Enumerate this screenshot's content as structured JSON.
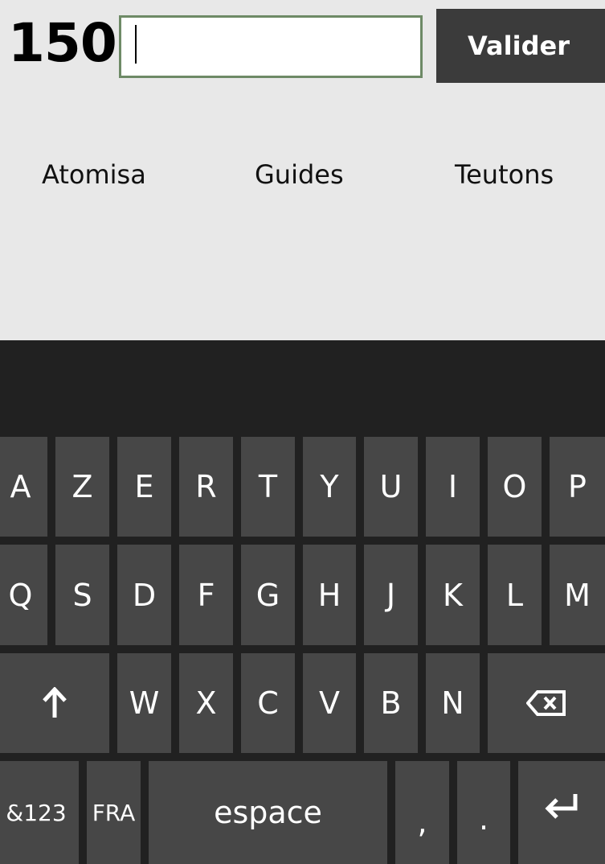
{
  "header": {
    "score": "150",
    "answer_input_value": "",
    "valider_label": "Valider"
  },
  "suggestions": [
    "Atomisa",
    "Guides",
    "Teutons"
  ],
  "keyboard": {
    "row1": [
      "A",
      "Z",
      "E",
      "R",
      "T",
      "Y",
      "U",
      "I",
      "O",
      "P"
    ],
    "row2": [
      "Q",
      "S",
      "D",
      "F",
      "G",
      "H",
      "J",
      "K",
      "L",
      "M"
    ],
    "row3": [
      "W",
      "X",
      "C",
      "V",
      "B",
      "N"
    ],
    "shift_icon": "up-arrow-icon",
    "backspace_icon": "backspace-icon",
    "enter_icon": "enter-arrow-icon",
    "symbols_label": "&123",
    "language_label": "FRA",
    "space_label": "espace",
    "comma_label": ",",
    "period_label": "."
  },
  "colors": {
    "background": "#e8e8e8",
    "keyboard_bg": "#212121",
    "key_bg": "#474747",
    "button_bg": "#3b3b3b",
    "input_border": "#6e8a66"
  }
}
